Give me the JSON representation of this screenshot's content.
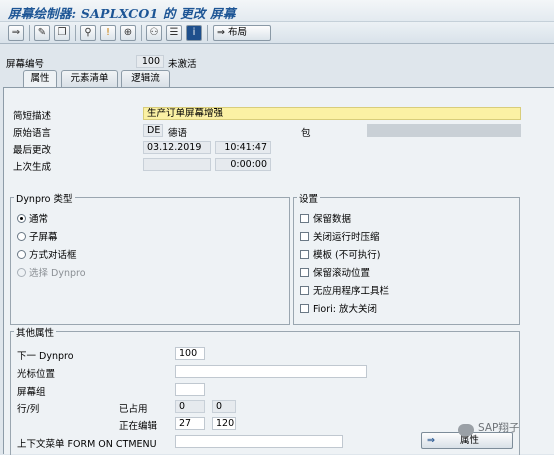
{
  "window": {
    "title": "屏幕绘制器: SAPLXCO1 的 更改 屏幕"
  },
  "toolbar": {
    "layout_label": "布局"
  },
  "header": {
    "screen_no_label": "屏幕编号",
    "screen_no_value": "100",
    "status_text": "未激活"
  },
  "tabs": [
    {
      "label": "属性"
    },
    {
      "label": "元素清单"
    },
    {
      "label": "逻辑流"
    }
  ],
  "attributes": {
    "short_desc_label": "简短描述",
    "short_desc_value": "生产订单屏幕增强",
    "orig_lang_label": "原始语言",
    "orig_lang_code": "DE",
    "orig_lang_name": "德语",
    "package_label": "包",
    "last_changed_label": "最后更改",
    "last_changed_date": "03.12.2019",
    "last_changed_time": "10:41:47",
    "last_generated_label": "上次生成",
    "last_generated_time": "0:00:00"
  },
  "dynpro_type": {
    "title": "Dynpro 类型",
    "options": [
      {
        "label": "通常",
        "selected": true
      },
      {
        "label": "子屏幕",
        "selected": false
      },
      {
        "label": "方式对话框",
        "selected": false
      },
      {
        "label": "选择 Dynpro",
        "selected": false,
        "disabled": true
      }
    ]
  },
  "settings": {
    "title": "设置",
    "options": [
      {
        "label": "保留数据"
      },
      {
        "label": "关闭运行时压缩"
      },
      {
        "label": "模板 (不可执行)"
      },
      {
        "label": "保留滚动位置"
      },
      {
        "label": "无应用程序工具栏"
      },
      {
        "label": "Fiori: 放大关闭"
      }
    ]
  },
  "other_attrs": {
    "title": "其他属性",
    "next_dynpro_label": "下一 Dynpro",
    "next_dynpro_value": "100",
    "cursor_pos_label": "光标位置",
    "screen_group_label": "屏幕组",
    "rowcol_label": "行/列",
    "used_label": "已占用",
    "used_row": "0",
    "used_col": "0",
    "editing_label": "正在编辑",
    "editing_row": "27",
    "editing_col": "120",
    "context_menu_label": "上下文菜单 FORM ON CTMENU",
    "attr_button_label": "属性"
  },
  "watermark": {
    "text": "SAP翔子"
  }
}
